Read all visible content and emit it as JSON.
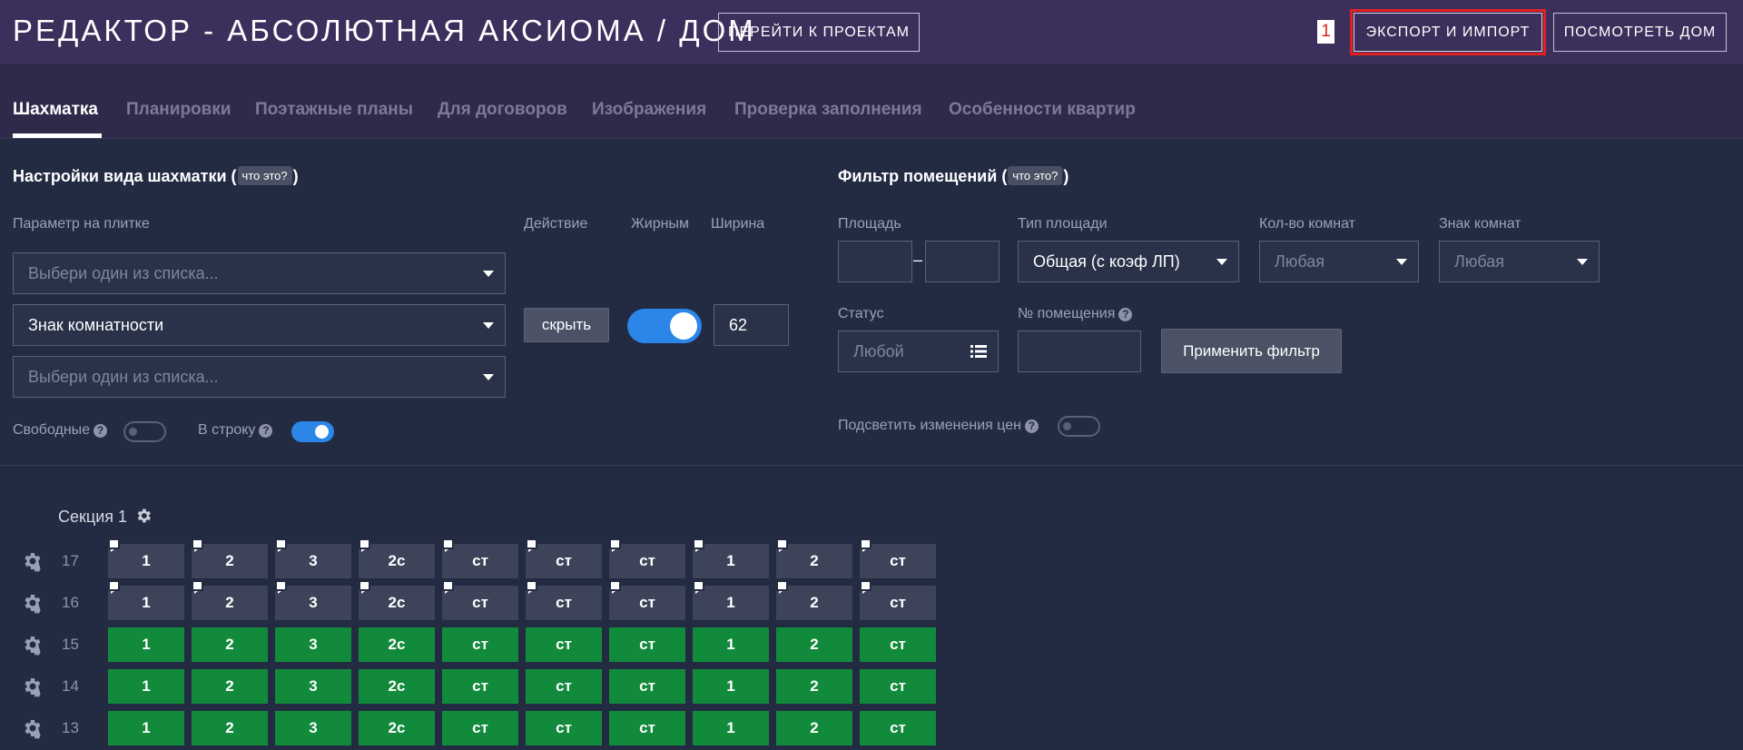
{
  "header": {
    "title": "РЕДАКТОР - АБСОЛЮТНАЯ АКСИОМА / ДОМ",
    "projects_button": "ПЕРЕЙТИ К ПРОЕКТАМ",
    "marker": "1",
    "export_button": "ЭКСПОРТ И ИМПОРТ",
    "view_button": "ПОСМОТРЕТЬ ДОМ"
  },
  "tabs": [
    {
      "label": "Шахматка",
      "active": true
    },
    {
      "label": "Планировки"
    },
    {
      "label": "Поэтажные планы"
    },
    {
      "label": "Для договоров"
    },
    {
      "label": "Изображения"
    },
    {
      "label": "Проверка заполнения"
    },
    {
      "label": "Особенности квартир"
    }
  ],
  "view_settings": {
    "title": "Настройки вида шахматки",
    "help": "что это?",
    "param_label": "Параметр на плитке",
    "action_label": "Действие",
    "bold_label": "Жирным",
    "width_label": "Ширина",
    "select1_placeholder": "Выбери один из списка...",
    "select2_value": "Знак комнатности",
    "select3_placeholder": "Выбери один из списка...",
    "hide_button": "скрыть",
    "bold_on": true,
    "width_value": "62",
    "free_label": "Свободные",
    "free_on": false,
    "inline_label": "В строку",
    "inline_on": true
  },
  "filter": {
    "title": "Фильтр помещений",
    "help": "что это?",
    "area_label": "Площадь",
    "area_from": "",
    "area_dash": "–",
    "area_to": "",
    "area_type_label": "Тип площади",
    "area_type_value": "Общая (с коэф ЛП)",
    "rooms_label": "Кол-во комнат",
    "rooms_placeholder": "Любая",
    "room_sign_label": "Знак комнат",
    "room_sign_placeholder": "Любая",
    "status_label": "Статус",
    "status_placeholder": "Любой",
    "unit_number_label": "№ помещения",
    "unit_number_value": "",
    "apply_button": "Применить фильтр",
    "highlight_label": "Подсветить изменения цен",
    "highlight_on": false
  },
  "grid": {
    "section_label": "Секция 1",
    "floors": [
      {
        "number": "17",
        "status": "gray",
        "comments": true,
        "cells": [
          "1",
          "2",
          "3",
          "2с",
          "ст",
          "ст",
          "ст",
          "1",
          "2",
          "ст"
        ]
      },
      {
        "number": "16",
        "status": "gray",
        "comments": true,
        "cells": [
          "1",
          "2",
          "3",
          "2с",
          "ст",
          "ст",
          "ст",
          "1",
          "2",
          "ст"
        ]
      },
      {
        "number": "15",
        "status": "green",
        "comments": false,
        "cells": [
          "1",
          "2",
          "3",
          "2с",
          "ст",
          "ст",
          "ст",
          "1",
          "2",
          "ст"
        ]
      },
      {
        "number": "14",
        "status": "green",
        "comments": false,
        "cells": [
          "1",
          "2",
          "3",
          "2с",
          "ст",
          "ст",
          "ст",
          "1",
          "2",
          "ст"
        ]
      },
      {
        "number": "13",
        "status": "green",
        "comments": false,
        "cells": [
          "1",
          "2",
          "3",
          "2с",
          "ст",
          "ст",
          "ст",
          "1",
          "2",
          "ст"
        ]
      }
    ]
  },
  "colors": {
    "header_bg": "#3d2f5c",
    "tabs_bg": "#2f2a4a",
    "page_bg": "#232b42",
    "accent_blue": "#2b86e8",
    "green_cell": "#128a3b",
    "gray_cell": "#3d4459",
    "highlight_red": "#e02020"
  }
}
